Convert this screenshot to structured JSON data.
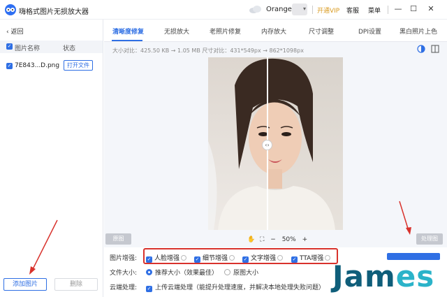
{
  "titlebar": {
    "app_title": "嗨格式图片无损放大器",
    "username": "Orange",
    "vip_label": "开通VIP",
    "service_label": "客服",
    "menu_label": "菜单",
    "minimize_glyph": "—",
    "maximize_glyph": "☐",
    "close_glyph": "✕",
    "dropdown_glyph": "▾"
  },
  "sidebar": {
    "back_label": "返回",
    "col_name": "图片名称",
    "col_status": "状态",
    "file": {
      "name": "7E843...D.png",
      "action": "打开文件"
    },
    "add_button": "添加图片",
    "delete_button": "删除"
  },
  "tabs": [
    {
      "label": "清晰度修复",
      "active": true
    },
    {
      "label": "无损放大",
      "active": false
    },
    {
      "label": "老照片修复",
      "active": false
    },
    {
      "label": "内存放大",
      "active": false
    },
    {
      "label": "尺寸调整",
      "active": false
    },
    {
      "label": "DPI设置",
      "active": false
    },
    {
      "label": "黑白照片上色",
      "active": false
    }
  ],
  "info_line": "大小对比：425.50 KB → 1.05 MB   尺寸对比：431*549px → 862*1098px",
  "viewer": {
    "original_button": "原图",
    "processed_button": "处理图",
    "zoom_minus": "−",
    "zoom_value": "50%",
    "zoom_plus": "+",
    "handle_glyph": "‹›"
  },
  "options": {
    "enhance_label": "图片增强:",
    "enhance_items": [
      {
        "label": "人脸增强",
        "checked": true
      },
      {
        "label": "细节增强",
        "checked": true
      },
      {
        "label": "文字增强",
        "checked": true
      },
      {
        "label": "TTA增强",
        "checked": true
      }
    ],
    "size_label": "文件大小:",
    "size_options": [
      {
        "label": "推荐大小（效果最佳）",
        "selected": true
      },
      {
        "label": "原图大小",
        "selected": false
      }
    ],
    "cloud_label": "云端处理:",
    "cloud_option": "上传云端处理（能提升处理速度，并解决本地处理失败问题）"
  },
  "watermark": {
    "text": "James"
  },
  "colors": {
    "accent": "#2f6fe4",
    "highlight": "#d8322c",
    "vip": "#d99a1f",
    "watermark_left": "#0f5e7a",
    "watermark_right": "#2bb3c9"
  }
}
